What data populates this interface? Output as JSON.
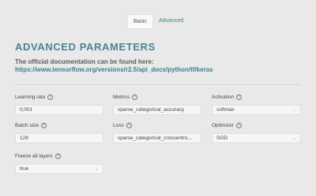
{
  "tabs": [
    {
      "label": "Basic",
      "active": true
    },
    {
      "label": "Advanced",
      "active": false
    }
  ],
  "section": {
    "title": "ADVANCED PARAMETERS",
    "doc_text": "The official documentation can be found here:",
    "doc_link": "https://www.tensorflow.org/versions/r2.5/api_docs/python/tf/keras"
  },
  "fields": {
    "learning_rate": {
      "label": "Learning rate",
      "value": "0,001"
    },
    "metrics": {
      "label": "Metrics",
      "value": "sparse_categorical_accuracy"
    },
    "activation": {
      "label": "Activation",
      "value": "softmax"
    },
    "batch_size": {
      "label": "Batch size",
      "value": "128"
    },
    "loss": {
      "label": "Loss",
      "value": "sparse_categorical_crossentro..."
    },
    "optimizer": {
      "label": "Optimizer",
      "value": "SGD"
    },
    "freeze_all_layers": {
      "label": "Freeze all layers",
      "value": "true"
    }
  },
  "icons": {
    "help": "question-circle-icon",
    "dropdown": "chevron-down-icon"
  },
  "colors": {
    "accent": "#4a8396",
    "link": "#3e7e8e",
    "background": "#e9e9e9"
  }
}
